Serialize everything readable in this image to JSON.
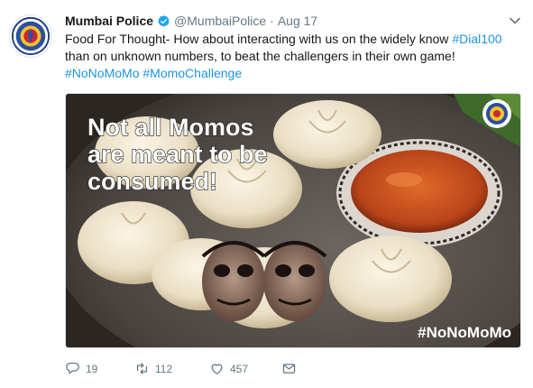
{
  "tweet": {
    "display_name": "Mumbai Police",
    "handle": "@MumbaiPolice",
    "separator": "·",
    "date": "Aug 17",
    "text_before": "Food For Thought- How about interacting with us on the widely know ",
    "link_dial": "#Dial100",
    "text_after": " than on unknown numbers, to beat the challengers in their own game!",
    "hashtag_1": "#NoNoMoMo",
    "hashtag_2": "#MomoChallenge",
    "space": " "
  },
  "media": {
    "headline_1": "Not all Momos",
    "headline_2": "are meant to be",
    "headline_3": "consumed!",
    "watermark": "#NoNoMoMo"
  },
  "actions": {
    "replies": "19",
    "retweets": "112",
    "likes": "457"
  },
  "colors": {
    "link": "#1b95e0",
    "muted": "#657786",
    "verified": "#1da1f2"
  }
}
